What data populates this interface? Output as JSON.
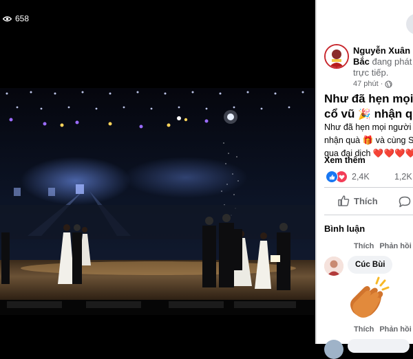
{
  "video": {
    "viewer_count": "658"
  },
  "post": {
    "author_name": "Nguyễn Xuân Bắc",
    "status": "đang phát trực tiếp.",
    "time": "47 phút",
    "title_line1": "Như đã hẹn mọi",
    "title_line2_a": "cổ vũ",
    "title_line2_b": "nhận qu",
    "body_line1": "Như đã hẹn mọi người",
    "body_line2_a": "nhận quà",
    "body_line2_b": "và cùng S",
    "body_line3": "qua đại dịch",
    "see_more": "Xem thêm",
    "reaction_count": "2,4K",
    "comment_count": "1,2K",
    "like_label": "Thích"
  },
  "comments": {
    "heading": "Bình luận",
    "action_like": "Thích",
    "action_reply": "Phản hồi",
    "items": [
      {
        "author": "Cúc Bùi"
      }
    ]
  },
  "colors": {
    "accent": "#1877f2",
    "heart": "#f33e58",
    "panel_bg": "#ffffff",
    "stage_bg": "#0a0f1c"
  }
}
